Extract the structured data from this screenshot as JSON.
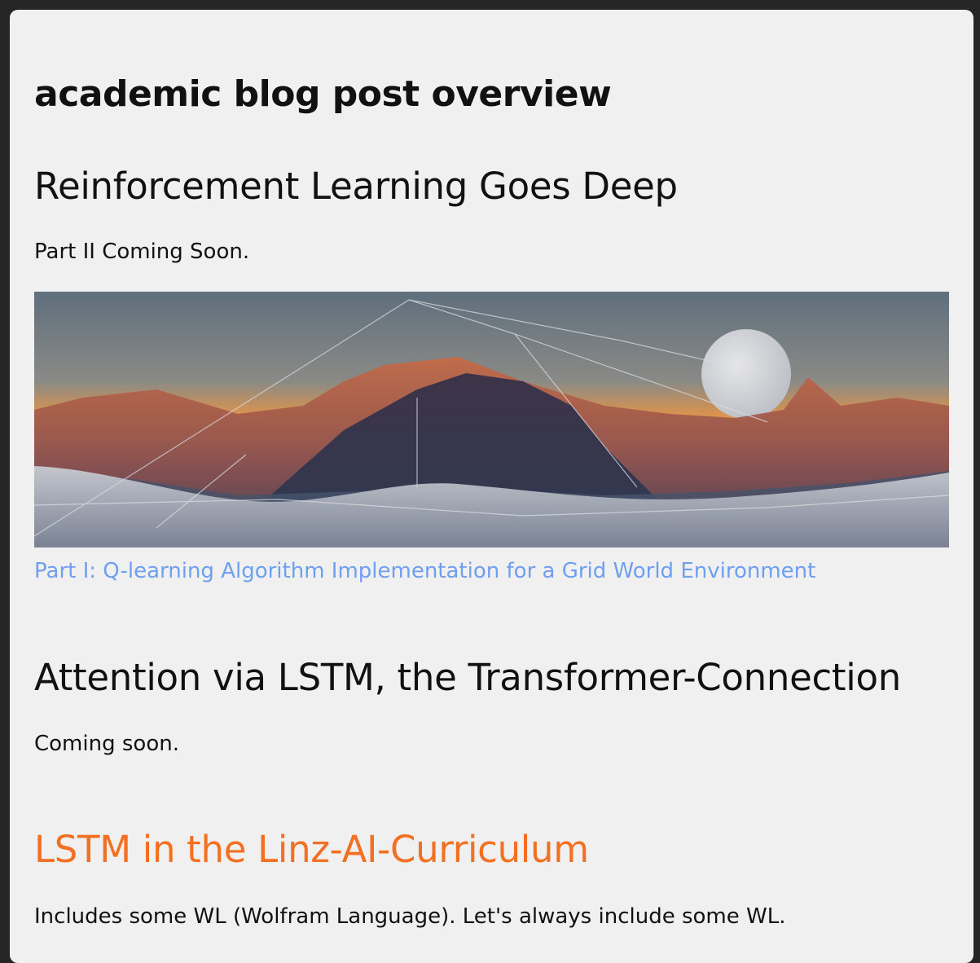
{
  "page": {
    "title": "academic blog post overview"
  },
  "posts": [
    {
      "title": "Reinforcement Learning Goes Deep",
      "text": "Part II Coming Soon.",
      "image": "mountain-sunset-illustration",
      "link": "Part I: Q-learning Algorithm Implementation for a Grid World Environment"
    },
    {
      "title": "Attention via LSTM, the Transformer-Connection",
      "text": "Coming soon."
    },
    {
      "title": "LSTM in the Linz-AI-Curriculum",
      "text": "Includes some WL (Wolfram Language). Let's always include some WL."
    }
  ],
  "colors": {
    "background": "#262626",
    "card": "#f0f0f0",
    "link": "#6e9ff0",
    "accent_title": "#f36f21"
  }
}
